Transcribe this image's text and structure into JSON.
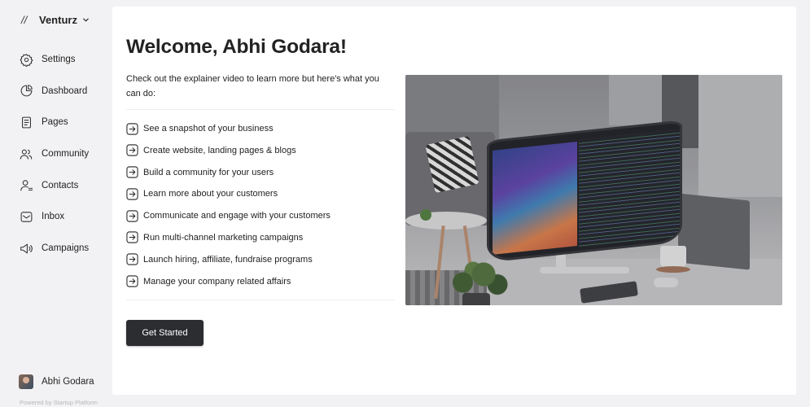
{
  "sidebar": {
    "brand": {
      "logo": "//",
      "name": "Venturz",
      "chevron_icon": "chevron-down-icon"
    },
    "items": [
      {
        "label": "Settings",
        "icon": "gear-icon"
      },
      {
        "label": "Dashboard",
        "icon": "pie-chart-icon"
      },
      {
        "label": "Pages",
        "icon": "document-icon"
      },
      {
        "label": "Community",
        "icon": "users-icon"
      },
      {
        "label": "Contacts",
        "icon": "contact-icon"
      },
      {
        "label": "Inbox",
        "icon": "inbox-icon"
      },
      {
        "label": "Campaigns",
        "icon": "megaphone-icon"
      }
    ],
    "user": {
      "name": "Abhi Godara"
    },
    "powered_by": "Powered by Startup Platform"
  },
  "main": {
    "title": "Welcome, Abhi Godara!",
    "intro": "Check out the explainer video to learn more but here's what you can do:",
    "features": [
      "See a snapshot of your business",
      "Create website, landing pages & blogs",
      "Build a community for your users",
      "Learn more about your customers",
      "Communicate and engage with your customers",
      "Run multi-channel marketing campaigns",
      "Launch hiring, affiliate, fundraise programs",
      "Manage your company related affairs"
    ],
    "feature_icon": "arrow-right-square-icon",
    "cta_label": "Get Started"
  },
  "colors": {
    "sidebar_bg": "#f2f2f4",
    "panel_bg": "#ffffff",
    "button_bg": "#2b2d31",
    "text": "#222222"
  }
}
